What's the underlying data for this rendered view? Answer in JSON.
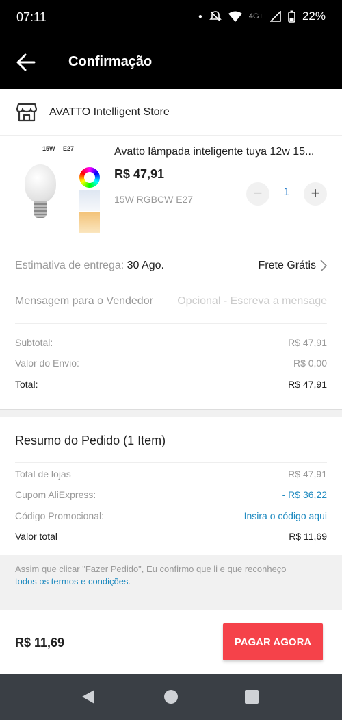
{
  "status_bar": {
    "time": "07:11",
    "network": "4G+",
    "battery": "22%"
  },
  "app_bar": {
    "title": "Confirmação"
  },
  "store": {
    "name": "AVATTO Intelligent Store"
  },
  "product": {
    "title": "Avatto lâmpada inteligente tuya 12w 15...",
    "price": "R$ 47,91",
    "variant": "15W RGBCW E27",
    "quantity": "1",
    "thumb_labels": [
      "15W",
      "E27"
    ]
  },
  "delivery": {
    "label": "Estimativa de entrega:",
    "date": "30 Ago.",
    "shipping": "Frete Grátis"
  },
  "message": {
    "label": "Mensagem para o Vendedor",
    "placeholder": "Opcional - Escreva a mensage"
  },
  "subtotals": [
    {
      "label": "Subtotal:",
      "value": "R$ 47,91"
    },
    {
      "label": "Valor do Envio:",
      "value": "R$ 0,00"
    },
    {
      "label": "Total:",
      "value": "R$ 47,91"
    }
  ],
  "summary": {
    "title": "Resumo do Pedido (1 Item)",
    "rows": [
      {
        "label": "Total de lojas",
        "value": "R$ 47,91"
      },
      {
        "label": "Cupom AliExpress:",
        "value": "- R$ 36,22"
      },
      {
        "label": "Código Promocional:",
        "value": "Insira o código aqui"
      },
      {
        "label": "Valor total",
        "value": "R$ 11,69"
      }
    ]
  },
  "terms": {
    "text": "Assim que clicar \"Fazer Pedido\", Eu confirmo que li e que reconheço",
    "link": "todos os termos e condições",
    "end": "."
  },
  "footer": {
    "total": "R$ 11,69",
    "pay_label": "PAGAR AGORA"
  },
  "colors": {
    "accent": "#f5424a",
    "link": "#1f8ac0",
    "quantity": "#1f78c8"
  }
}
